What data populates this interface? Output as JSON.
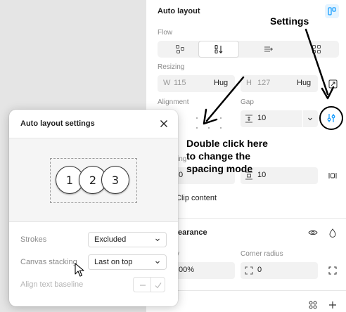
{
  "panel": {
    "title": "Auto layout",
    "flow_label": "Flow",
    "resizing_label": "Resizing",
    "width_prefix": "W",
    "width_value": "115",
    "width_mode": "Hug",
    "height_prefix": "H",
    "height_value": "127",
    "height_mode": "Hug",
    "alignment_label": "Alignment",
    "gap_label": "Gap",
    "gap_value": "10",
    "padding_label_partial": "ing",
    "padding_h_value": "0",
    "padding_v_value": "10",
    "clip_content_label": "Clip content",
    "appearance_title_partial": "earance",
    "opacity_label_partial": "y",
    "opacity_value_partial": "00%",
    "corner_radius_label": "Corner radius",
    "corner_radius_value": "0"
  },
  "dialog": {
    "title": "Auto layout settings",
    "circles": [
      "1",
      "2",
      "3"
    ],
    "strokes_label": "Strokes",
    "strokes_value": "Excluded",
    "canvas_stacking_label": "Canvas stacking",
    "canvas_stacking_value": "Last on top",
    "align_text_baseline_label": "Align text baseline"
  },
  "annotations": {
    "settings": "Settings",
    "double_click_line1": "Double click here",
    "double_click_line2": "to change the",
    "double_click_line3": "spacing mode"
  },
  "icons": {
    "flow_options": [
      "grid-free-icon",
      "vertical-flow-icon",
      "horizontal-flow-icon",
      "wrap-grid-icon"
    ],
    "highlight_color": "#000000",
    "accent": "#0d99ff"
  }
}
